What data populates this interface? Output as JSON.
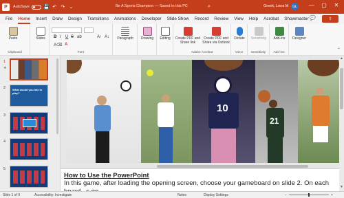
{
  "titlebar": {
    "autosave_label": "AutoSave",
    "toggle_state": "Off",
    "doc_title": "Be A Sports Champion — Saved to this PC",
    "user_name": "Greek, Lena M",
    "user_initials": "GL",
    "logo_letter": "P",
    "quick_save": "💾",
    "quick_undo": "↶",
    "quick_redo": "↷",
    "quick_more": "⌄",
    "search_glyph": "⌕",
    "minimize": "—",
    "maximize": "▢",
    "close": "✕",
    "brand_color": "#c43e1c"
  },
  "menu": {
    "tabs": [
      "File",
      "Home",
      "Insert",
      "Draw",
      "Design",
      "Transitions",
      "Animations",
      "Developer",
      "Slide Show",
      "Record",
      "Review",
      "View",
      "Help",
      "Acrobat",
      "Showmaster"
    ],
    "active": "Home",
    "comment_glyph": "💬",
    "share_glyph": "⇪"
  },
  "ribbon": {
    "clipboard": {
      "paste": "Paste",
      "label": "Clipboard"
    },
    "slides": {
      "slides": "Slides"
    },
    "font": {
      "label": "Font",
      "bold": "B",
      "italic": "I",
      "underline": "U",
      "strike": "S",
      "shadow": "ab",
      "grow": "A↑",
      "shrink": "A↓",
      "clear": "A⌫",
      "color": "A"
    },
    "paragraph": {
      "paragraph": "Paragraph"
    },
    "drawing": {
      "drawing": "Drawing"
    },
    "editing": {
      "editing": "Editing"
    },
    "acrobat": {
      "create_share": "Create PDF and Share link",
      "create_outlook": "Create PDF and Share via Outlook",
      "label": "Adobe Acrobat"
    },
    "voice": {
      "dictate": "Dictate",
      "label": "Voice"
    },
    "sensitivity": {
      "sensitivity": "Sensitivity",
      "label": "Sensitivity"
    },
    "addins": {
      "addins": "Add-ins",
      "label": "Add-ins"
    },
    "designer": {
      "designer": "Designer"
    },
    "collapse_glyph": "⌃"
  },
  "thumbs": {
    "numbers": [
      "1",
      "2",
      "3",
      "4",
      "5"
    ],
    "star": "★",
    "slide2_text": "What would you like to play?",
    "scoreboard_glyph": "00"
  },
  "slide": {
    "jersey_numbers": [
      "10",
      "21"
    ]
  },
  "notes": {
    "title": "How to Use the PowerPoint",
    "line1": "In this game, after loading the opening screen, choose your gameboard on slide 2. On each",
    "line2": "board...s go..."
  },
  "scroll": {
    "up": "▲",
    "down": "▼"
  },
  "status": {
    "slide_info": "Slide 1 of 9",
    "accessibility": "Accessibility: Investigate",
    "notes": "Notes",
    "display": "Display Settings",
    "zoom_minus": "−",
    "zoom_plus": "+",
    "zoom_level": 0.48
  }
}
